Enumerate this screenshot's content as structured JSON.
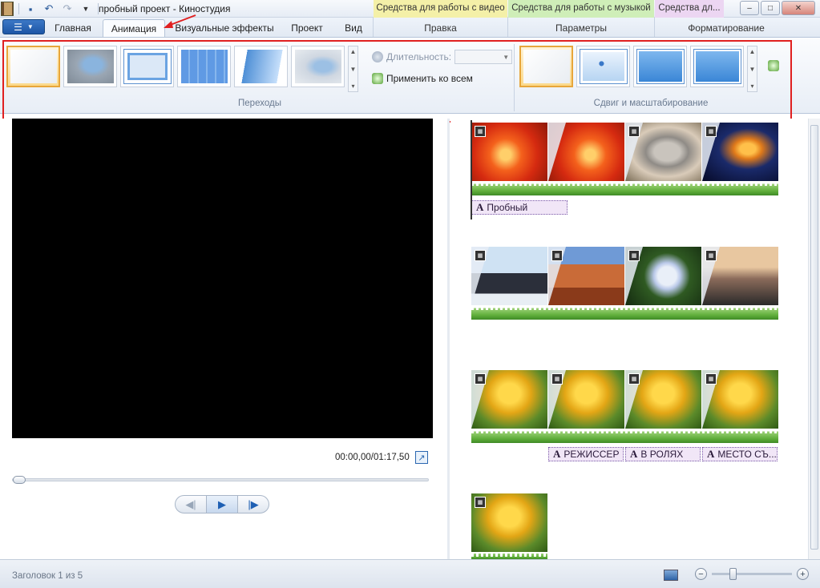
{
  "window": {
    "title": "пробный проект - Киностудия",
    "contextual_tabs": {
      "video_tools": "Средства для работы с видео",
      "music_tools": "Средства для работы с музыкой",
      "text_tools": "Средства дл..."
    },
    "controls": {
      "minimize": "–",
      "maximize": "□",
      "close": "✕"
    }
  },
  "tabs": [
    {
      "label": "Главная"
    },
    {
      "label": "Анимация",
      "active": true
    },
    {
      "label": "Визуальные эффекты"
    },
    {
      "label": "Проект"
    },
    {
      "label": "Вид"
    }
  ],
  "context_groups": {
    "edit": "Правка",
    "options": "Параметры",
    "format": "Форматирование"
  },
  "ribbon": {
    "transitions": {
      "group_label": "Переходы",
      "duration_label": "Длительность:",
      "duration_value": "",
      "apply_all_label": "Применить ко всем"
    },
    "pan_zoom": {
      "group_label": "Сдвиг и масштабирование"
    }
  },
  "preview": {
    "timecode": "00:00,00/01:17,50"
  },
  "storyboard": {
    "captions": {
      "row1": "Пробный",
      "row3a": "РЕЖИССЕР",
      "row3b": "В РОЛЯХ",
      "row3c": "МЕСТО СЪ..."
    }
  },
  "status": {
    "text": "Заголовок 1 из 5"
  },
  "colors": {
    "accent_blue": "#1d56a6",
    "highlight_red": "#e02020",
    "video_ctx": "#f4f0a8",
    "music_ctx": "#cfeeb8",
    "text_ctx": "#ecd6f2"
  }
}
